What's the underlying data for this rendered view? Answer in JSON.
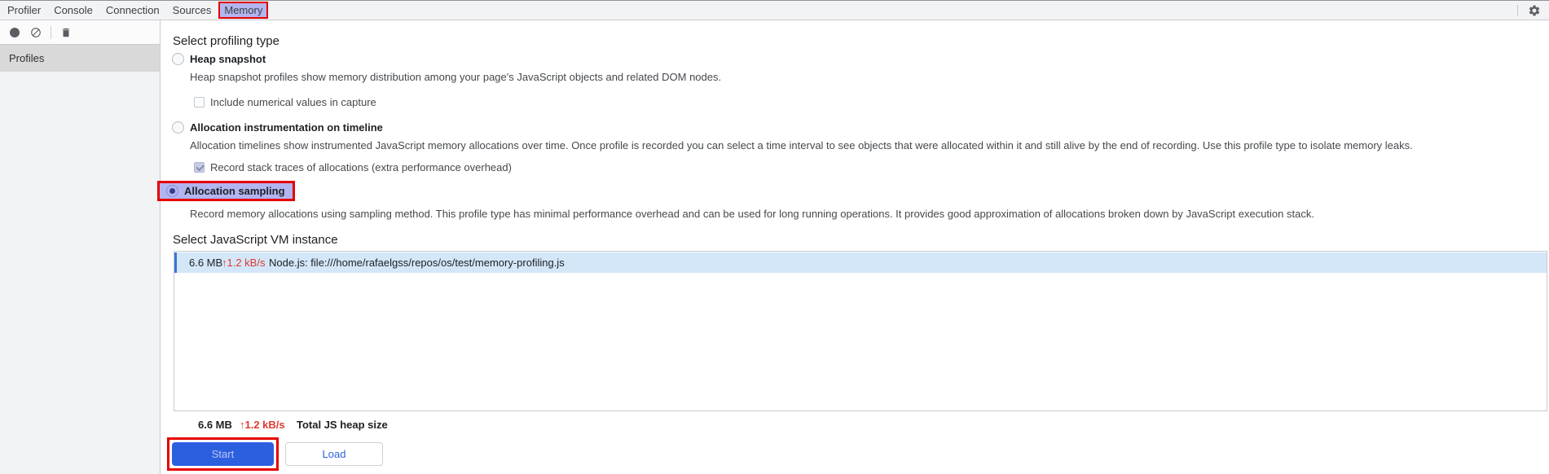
{
  "tabbar": {
    "tabs": [
      {
        "label": "Profiler"
      },
      {
        "label": "Console"
      },
      {
        "label": "Connection"
      },
      {
        "label": "Sources"
      },
      {
        "label": "Memory",
        "selected": true
      }
    ]
  },
  "toolbar": {
    "icons": [
      "record",
      "clear",
      "delete"
    ]
  },
  "sidebar": {
    "header_label": "Profiles"
  },
  "profiling": {
    "heading": "Select profiling type",
    "options": [
      {
        "label": "Heap snapshot",
        "selected": false,
        "desc": "Heap snapshot profiles show memory distribution among your page's JavaScript objects and related DOM nodes.",
        "checkbox_label": "Include numerical values in capture",
        "checkbox_checked": false
      },
      {
        "label": "Allocation instrumentation on timeline",
        "selected": false,
        "desc": "Allocation timelines show instrumented JavaScript memory allocations over time. Once profile is recorded you can select a time interval to see objects that were allocated within it and still alive by the end of recording. Use this profile type to isolate memory leaks.",
        "checkbox_label": "Record stack traces of allocations (extra performance overhead)",
        "checkbox_checked": true
      },
      {
        "label": "Allocation sampling",
        "selected": true,
        "desc": "Record memory allocations using sampling method. This profile type has minimal performance overhead and can be used for long running operations. It provides good approximation of allocations broken down by JavaScript execution stack."
      }
    ]
  },
  "vm": {
    "heading": "Select JavaScript VM instance",
    "instances": [
      {
        "heap_size": "6.6 MB",
        "rate": "↑1.2 kB/s",
        "name": "Node.js: file:///home/rafaelgss/repos/os/test/memory-profiling.js",
        "selected": true
      }
    ],
    "total": {
      "heap_size": "6.6 MB",
      "rate": "↑1.2 kB/s",
      "label": "Total JS heap size"
    }
  },
  "buttons": {
    "start": "Start",
    "load": "Load"
  },
  "colors": {
    "annotation_red": "#e60000",
    "selection_lavender": "#b2b5f0",
    "vm_row_highlight": "#d4e7f9",
    "vm_row_accent": "#3c74d9",
    "primary_button_blue": "#2c5fe0",
    "rate_red": "#dc3b30"
  }
}
